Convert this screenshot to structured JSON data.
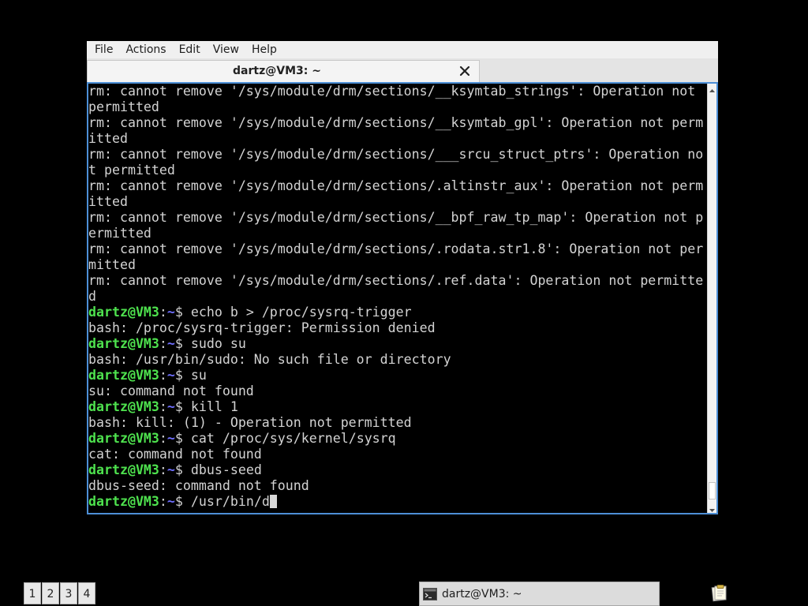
{
  "window": {
    "menu": [
      "File",
      "Actions",
      "Edit",
      "View",
      "Help"
    ],
    "tab_title": "dartz@VM3: ~"
  },
  "terminal": {
    "prompt_user": "dartz@VM3",
    "prompt_dir": "~",
    "lines": [
      {
        "type": "out",
        "text": "rm: cannot remove '/sys/module/drm/sections/__ksymtab_strings': Operation not"
      },
      {
        "type": "out",
        "text": "permitted"
      },
      {
        "type": "out",
        "text": "rm: cannot remove '/sys/module/drm/sections/__ksymtab_gpl': Operation not perm"
      },
      {
        "type": "out",
        "text": "itted"
      },
      {
        "type": "out",
        "text": "rm: cannot remove '/sys/module/drm/sections/___srcu_struct_ptrs': Operation no"
      },
      {
        "type": "out",
        "text": "t permitted"
      },
      {
        "type": "out",
        "text": "rm: cannot remove '/sys/module/drm/sections/.altinstr_aux': Operation not perm"
      },
      {
        "type": "out",
        "text": "itted"
      },
      {
        "type": "out",
        "text": "rm: cannot remove '/sys/module/drm/sections/__bpf_raw_tp_map': Operation not p"
      },
      {
        "type": "out",
        "text": "ermitted"
      },
      {
        "type": "out",
        "text": "rm: cannot remove '/sys/module/drm/sections/.rodata.str1.8': Operation not per"
      },
      {
        "type": "out",
        "text": "mitted"
      },
      {
        "type": "out",
        "text": "rm: cannot remove '/sys/module/drm/sections/.ref.data': Operation not permitte"
      },
      {
        "type": "out",
        "text": "d"
      },
      {
        "type": "cmd",
        "text": "echo b > /proc/sysrq-trigger"
      },
      {
        "type": "out",
        "text": "bash: /proc/sysrq-trigger: Permission denied"
      },
      {
        "type": "cmd",
        "text": "sudo su"
      },
      {
        "type": "out",
        "text": "bash: /usr/bin/sudo: No such file or directory"
      },
      {
        "type": "cmd",
        "text": "su"
      },
      {
        "type": "out",
        "text": "su: command not found"
      },
      {
        "type": "cmd",
        "text": "kill 1"
      },
      {
        "type": "out",
        "text": "bash: kill: (1) - Operation not permitted"
      },
      {
        "type": "cmd",
        "text": "cat /proc/sys/kernel/sysrq"
      },
      {
        "type": "out",
        "text": "cat: command not found"
      },
      {
        "type": "cmd",
        "text": "dbus-seed"
      },
      {
        "type": "out",
        "text": "dbus-seed: command not found"
      },
      {
        "type": "cmd_active",
        "text": "/usr/bin/d"
      }
    ]
  },
  "taskbar": {
    "workspaces": [
      "1",
      "2",
      "3",
      "4"
    ],
    "task_label": "dartz@VM3: ~",
    "tray_icon": "notes-icon"
  },
  "colors": {
    "prompt_user": "#4ee24e",
    "prompt_dir": "#6f6fff",
    "text": "#d3d3d3",
    "focus_border": "#4d8fd6",
    "background": "#000000"
  }
}
